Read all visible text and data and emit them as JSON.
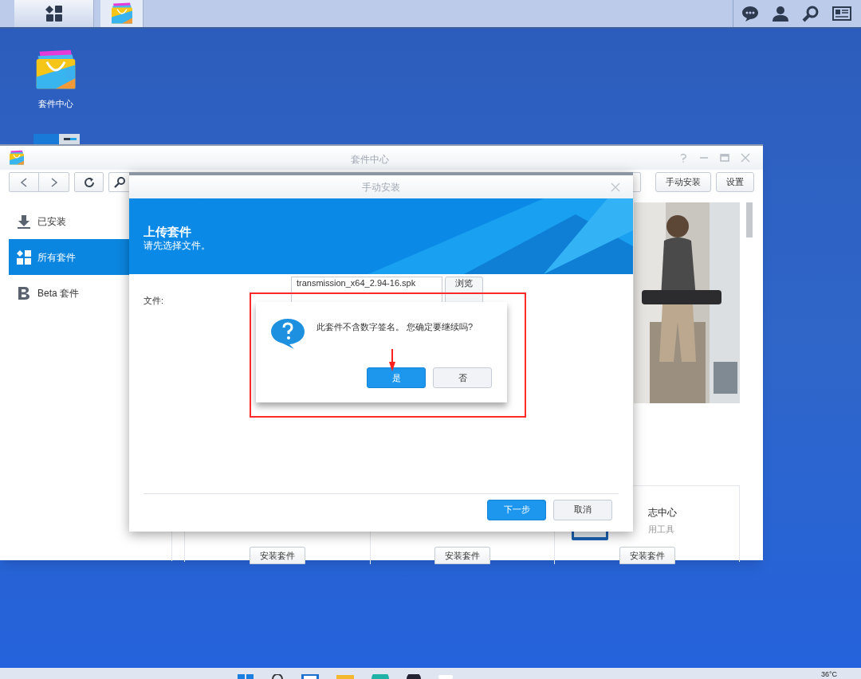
{
  "top_bar": {
    "tabs": [
      {
        "kind": "main_menu",
        "selected": false
      },
      {
        "kind": "package_center",
        "selected": true
      }
    ]
  },
  "desktop_icons": [
    {
      "label": "套件中心"
    }
  ],
  "window": {
    "title": "套件中心",
    "toolbar_buttons": [
      "手动安装",
      "设置"
    ],
    "sidebar": {
      "items": [
        {
          "label": "已安装",
          "selected": false
        },
        {
          "label": "所有套件",
          "selected": true
        },
        {
          "label": "Beta 套件",
          "selected": false
        }
      ]
    },
    "cards": [
      {
        "button": "安装套件"
      },
      {
        "button": "安装套件"
      },
      {
        "title": "志中心",
        "subtitle": "用工具",
        "button": "安装套件"
      }
    ]
  },
  "manual_install_dialog": {
    "title": "手动安装",
    "header_title": "上传套件",
    "header_subtitle": "请先选择文件。",
    "file_label": "文件:",
    "file_value": "transmission_x64_2.94-16.spk",
    "browse_button": "浏览",
    "buttons": [
      {
        "label": "下一步",
        "primary": true
      },
      {
        "label": "取消",
        "primary": false
      }
    ]
  },
  "confirm_dialog": {
    "message": "此套件不含数字签名。 您确定要继续吗?",
    "buttons": [
      {
        "label": "是",
        "primary": true
      },
      {
        "label": "否",
        "primary": false
      }
    ]
  },
  "taskbar": {
    "temperature": "36°C"
  }
}
